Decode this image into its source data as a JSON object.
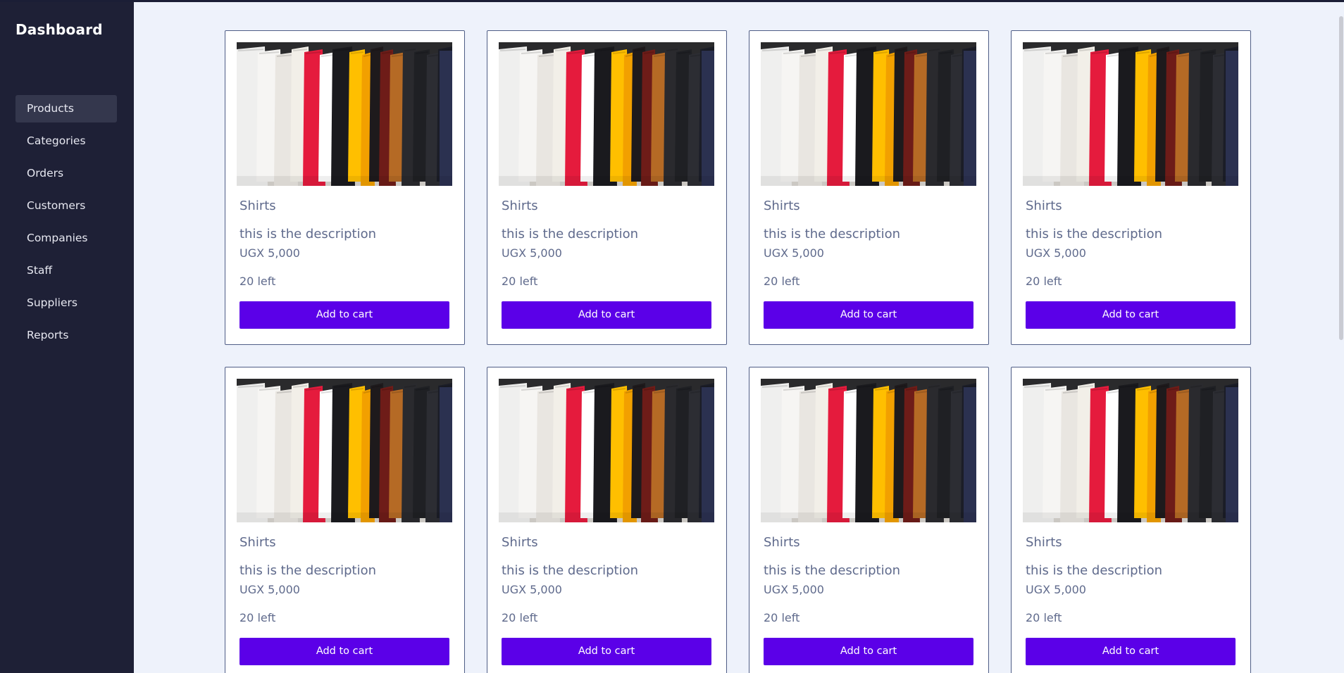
{
  "sidebar": {
    "title": "Dashboard",
    "items": [
      {
        "label": "Products",
        "active": true
      },
      {
        "label": "Categories"
      },
      {
        "label": "Orders"
      },
      {
        "label": "Customers"
      },
      {
        "label": "Companies"
      },
      {
        "label": "Staff"
      },
      {
        "label": "Suppliers"
      },
      {
        "label": "Reports"
      }
    ]
  },
  "products": [
    {
      "name": "Shirts",
      "description": "this is the description",
      "price": "UGX 5,000",
      "stock": "20 left",
      "button": "Add to cart",
      "image": "clothes-rack-image"
    },
    {
      "name": "Shirts",
      "description": "this is the description",
      "price": "UGX 5,000",
      "stock": "20 left",
      "button": "Add to cart",
      "image": "clothes-rack-image"
    },
    {
      "name": "Shirts",
      "description": "this is the description",
      "price": "UGX 5,000",
      "stock": "20 left",
      "button": "Add to cart",
      "image": "clothes-rack-image"
    },
    {
      "name": "Shirts",
      "description": "this is the description",
      "price": "UGX 5,000",
      "stock": "20 left",
      "button": "Add to cart",
      "image": "clothes-rack-image"
    },
    {
      "name": "Shirts",
      "description": "this is the description",
      "price": "UGX 5,000",
      "stock": "20 left",
      "button": "Add to cart",
      "image": "clothes-rack-image"
    },
    {
      "name": "Shirts",
      "description": "this is the description",
      "price": "UGX 5,000",
      "stock": "20 left",
      "button": "Add to cart",
      "image": "clothes-rack-image"
    },
    {
      "name": "Shirts",
      "description": "this is the description",
      "price": "UGX 5,000",
      "stock": "20 left",
      "button": "Add to cart",
      "image": "clothes-rack-image"
    },
    {
      "name": "Shirts",
      "description": "this is the description",
      "price": "UGX 5,000",
      "stock": "20 left",
      "button": "Add to cart",
      "image": "clothes-rack-image"
    }
  ],
  "colors": {
    "sidebar_bg": "#1e2036",
    "active_item_bg": "#34374d",
    "page_bg": "#eef2fb",
    "button_bg": "#5b00e8",
    "card_border": "#4f5d86",
    "text_muted": "#5f6a8c"
  }
}
